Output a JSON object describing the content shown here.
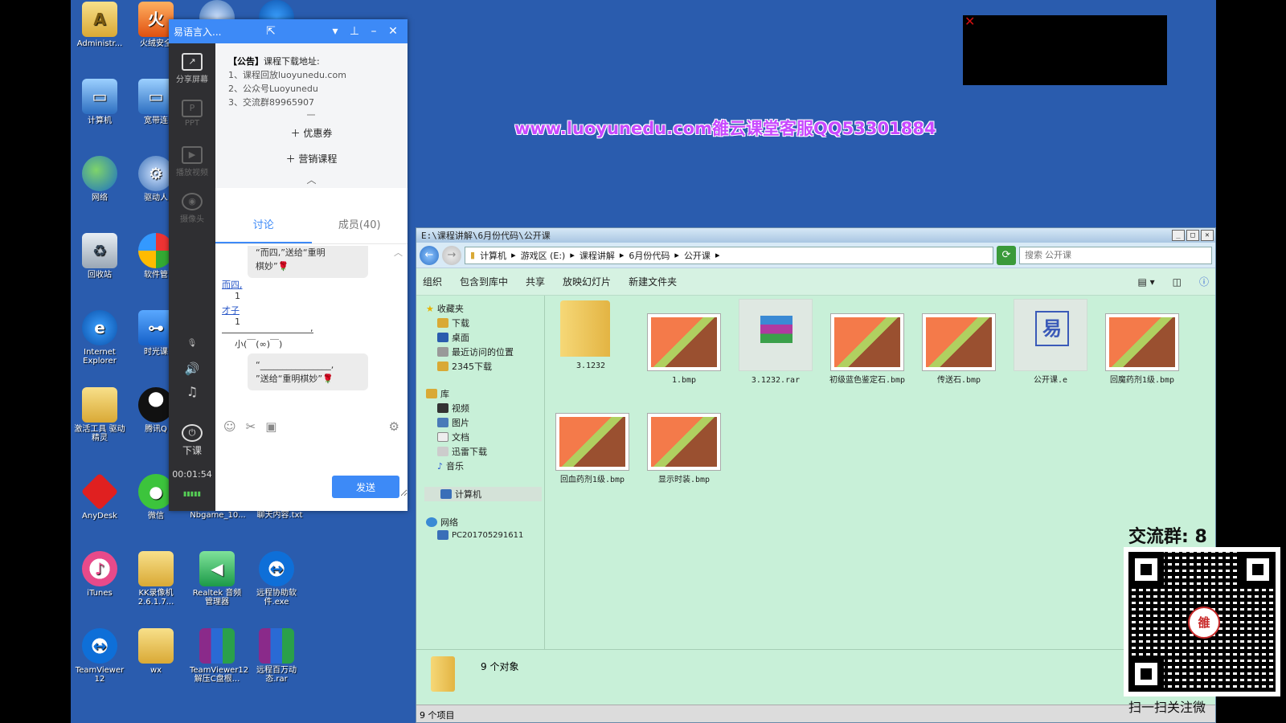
{
  "desktop_icons": [
    {
      "label": "Administr...",
      "icon": "user-folder-icon"
    },
    {
      "label": "火绒安全",
      "icon": "huorong-icon"
    },
    {
      "label": "计算机",
      "icon": "computer-icon"
    },
    {
      "label": "宽带连",
      "icon": "broadband-icon"
    },
    {
      "label": "网络",
      "icon": "network-icon"
    },
    {
      "label": "驱动人",
      "icon": "driver-icon"
    },
    {
      "label": "回收站",
      "icon": "recycle-bin-icon"
    },
    {
      "label": "软件管",
      "icon": "software-manager-icon"
    },
    {
      "label": "Internet Explorer",
      "icon": "ie-icon"
    },
    {
      "label": "时光课",
      "icon": "class-icon"
    },
    {
      "label": "激活工具 驱动精灵",
      "icon": "folder-icon"
    },
    {
      "label": "腾讯Q",
      "icon": "qq-icon"
    },
    {
      "label": "AnyDesk",
      "icon": "anydesk-icon"
    },
    {
      "label": "微信",
      "icon": "wechat-icon"
    },
    {
      "label": "Nbgame_10...",
      "icon": "nbgame-icon"
    },
    {
      "label": "聊天内容.txt",
      "icon": "txt-icon"
    },
    {
      "label": "iTunes",
      "icon": "itunes-icon"
    },
    {
      "label": "KK录像机 2.6.1.7...",
      "icon": "folder-icon"
    },
    {
      "label": "Realtek 音频管理器",
      "icon": "audio-icon"
    },
    {
      "label": "远程协助软件.exe",
      "icon": "teamviewer-icon"
    },
    {
      "label": "TeamViewer 12",
      "icon": "teamviewer-icon"
    },
    {
      "label": "wx",
      "icon": "folder-icon"
    },
    {
      "label": "TeamViewer12 解压C盘根...",
      "icon": "rar-icon"
    },
    {
      "label": "远程百万动态.rar",
      "icon": "rar-icon"
    }
  ],
  "chat": {
    "title": "易语言入...",
    "side": {
      "share": "分享屏幕",
      "ppt": "PPT",
      "video": "播放视频",
      "camera": "摄像头",
      "end": "下课",
      "timer": "00:01:54"
    },
    "notice": {
      "head_bracket": "【公告】",
      "head_text": "课程下载地址:",
      "lines": [
        "1、课程回放luoyunedu.com",
        "2、公众号Luoyunedu",
        "3、交流群89965907"
      ]
    },
    "coupon": "优惠券",
    "marketing": "营销课程",
    "tabs": [
      "讨论",
      "成员(40)"
    ],
    "messages": {
      "bubble1_line1": "“而四,”送给“重明",
      "bubble1_line2": "棋妙”🌹",
      "m1": "而四,",
      "m1n": "1",
      "m2": "才子",
      "m2n": "1",
      "comma": ",",
      "emoticon": "小(￣(∞)￣)",
      "bubble2_line1": "“________________,",
      "bubble2_line2": "”送给“重明棋妙”🌹"
    },
    "send": "发送"
  },
  "banner": "www.luoyunedu.com雒云课堂客服QQ53301884",
  "explorer": {
    "title": "E:\\课程讲解\\6月份代码\\公开课",
    "breadcrumbs": [
      "计算机",
      "游戏区 (E:)",
      "课程讲解",
      "6月份代码",
      "公开课"
    ],
    "search_placeholder": "搜索 公开课",
    "toolbar": [
      "组织",
      "包含到库中",
      "共享",
      "放映幻灯片",
      "新建文件夹"
    ],
    "nav": {
      "favorites": "收藏夹",
      "downloads": "下载",
      "desktop": "桌面",
      "recent": "最近访问的位置",
      "d2345": "2345下载",
      "libraries": "库",
      "videos": "视频",
      "pictures": "图片",
      "documents": "文档",
      "xunlei": "迅雷下载",
      "music": "音乐",
      "computer": "计算机",
      "network": "网络",
      "pc": "PC201705291611"
    },
    "files": [
      {
        "name": "3.1232",
        "kind": "folder"
      },
      {
        "name": "1.bmp",
        "kind": "bmp"
      },
      {
        "name": "3.1232.rar",
        "kind": "rar"
      },
      {
        "name": "初级蓝色鉴定石.bmp",
        "kind": "bmp"
      },
      {
        "name": "传送石.bmp",
        "kind": "bmp"
      },
      {
        "name": "公开课.e",
        "kind": "e"
      },
      {
        "name": "回魔药剂1级.bmp",
        "kind": "bmp"
      },
      {
        "name": "回血药剂1级.bmp",
        "kind": "bmp"
      },
      {
        "name": "显示时装.bmp",
        "kind": "bmp"
      }
    ],
    "detail": "9 个对象",
    "status": "9 个项目"
  },
  "overlay": {
    "group_label": "交流群: 8",
    "qr_caption": "扫一扫关注微",
    "qr_seal": "雒"
  },
  "colors": {
    "desktop": "#2a5cae",
    "chat_accent": "#3d8af7",
    "explorer_bg": "#c8f0d8",
    "banner": "#c848ff"
  }
}
